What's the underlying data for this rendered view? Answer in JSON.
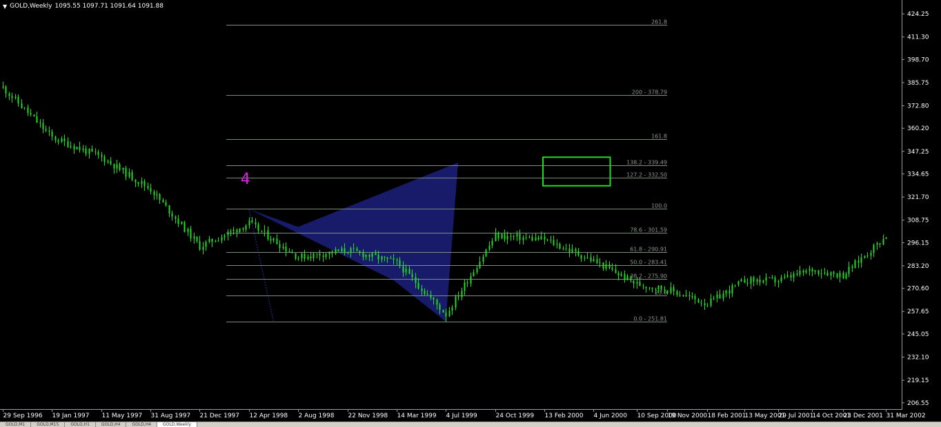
{
  "header": {
    "symbol": "GOLD,Weekly",
    "ohlc": "1095.55 1097.71 1091.64 1091.88"
  },
  "tabs": [
    "GOLD,M1",
    "GOLD,M15",
    "GOLD,H1",
    "GOLD,H4",
    "GOLD,H4",
    "GOLD,Weekly"
  ],
  "active_tab": 5,
  "annotation_label": "4",
  "colors": {
    "background": "#000000",
    "candle": "#22dd22",
    "pattern_fill": "#1a1f78",
    "fib_line": "#7f8f7f",
    "fib_text": "#8d958d",
    "highlight_box": "#22dd22",
    "label_color": "#e020e0",
    "axis_text": "#ffffff"
  },
  "chart_data": {
    "type": "candlestick",
    "title": "",
    "y_axis": {
      "position": "right",
      "range": [
        203,
        432
      ]
    },
    "y_ticks": [
      "424.25",
      "411.30",
      "398.70",
      "385.75",
      "372.80",
      "360.20",
      "347.25",
      "334.65",
      "321.70",
      "308.75",
      "296.15",
      "283.20",
      "270.60",
      "257.65",
      "245.05",
      "232.10",
      "219.15",
      "206.55"
    ],
    "x_ticks": [
      "29 Sep 1996",
      "19 Jan 1997",
      "11 May 1997",
      "31 Aug 1997",
      "21 Dec 1997",
      "12 Apr 1998",
      "2 Aug 1998",
      "22 Nov 1998",
      "14 Mar 1999",
      "4 Jul 1999",
      "24 Oct 1999",
      "13 Feb 2000",
      "4 Jun 2000",
      "10 Sep 2000",
      "19 Nov 2000",
      "18 Feb 2001",
      "13 May 2001",
      "29 Jul 2001",
      "14 Oct 2001",
      "23 Dec 2001",
      "31 Mar 2002"
    ],
    "price_path": [
      {
        "x": "29 Sep 1996",
        "y": 383
      },
      {
        "x": "19 Jan 1997",
        "y": 355
      },
      {
        "x": "11 May 1997",
        "y": 344
      },
      {
        "x": "31 Aug 1997",
        "y": 326
      },
      {
        "x": "21 Dec 1997",
        "y": 294
      },
      {
        "x": "12 Apr 1998",
        "y": 307
      },
      {
        "x": "2 Aug 1998",
        "y": 288
      },
      {
        "x": "22 Nov 1998",
        "y": 292
      },
      {
        "x": "14 Mar 1999",
        "y": 285
      },
      {
        "x": "4 Jul 1999",
        "y": 256
      },
      {
        "x": "24 Oct 1999",
        "y": 300
      },
      {
        "x": "13 Feb 2000",
        "y": 298
      },
      {
        "x": "4 Jun 2000",
        "y": 286
      },
      {
        "x": "10 Sep 2000",
        "y": 273
      },
      {
        "x": "19 Nov 2000",
        "y": 270
      },
      {
        "x": "18 Feb 2001",
        "y": 262
      },
      {
        "x": "13 May 2001",
        "y": 275
      },
      {
        "x": "29 Jul 2001",
        "y": 275
      },
      {
        "x": "14 Oct 2001",
        "y": 281
      },
      {
        "x": "23 Dec 2001",
        "y": 278
      },
      {
        "x": "31 Mar 2002",
        "y": 300
      }
    ],
    "fibonacci_levels": [
      {
        "label": "261.8",
        "value": 418
      },
      {
        "label": "200 - 378.79",
        "value": 378.79
      },
      {
        "label": "161.8",
        "value": 354
      },
      {
        "label": "138.2 - 339.49",
        "value": 339.49
      },
      {
        "label": "127.2 - 332.50",
        "value": 332.5
      },
      {
        "label": "100.0",
        "value": 315
      },
      {
        "label": "78.6 - 301.59",
        "value": 301.59
      },
      {
        "label": "61.8 - 290.91",
        "value": 290.91
      },
      {
        "label": "50.0 - 283.41",
        "value": 283.41
      },
      {
        "label": "38.2 - 275.90",
        "value": 275.9
      },
      {
        "label": "23.6",
        "value": 266.5
      },
      {
        "label": "0.0 - 251.81",
        "value": 251.81
      }
    ],
    "pattern": {
      "points": [
        {
          "x": "12 Apr 1998",
          "y": 315
        },
        {
          "x": "2 Aug 1998",
          "y": 305
        },
        {
          "x": "1 Aug 1999",
          "y": 341
        },
        {
          "x": "4 Jul 1999",
          "y": 252
        },
        {
          "x": "8 Mar 1999",
          "y": 275
        }
      ],
      "projection": [
        {
          "x": "12 Apr 1998",
          "y": 315
        },
        {
          "x": "7 Jun 1998",
          "y": 252
        }
      ]
    },
    "highlight_box": {
      "top": 344,
      "bottom": 328,
      "from": "10 Feb 2000",
      "to": "12 Jul 2000"
    }
  }
}
